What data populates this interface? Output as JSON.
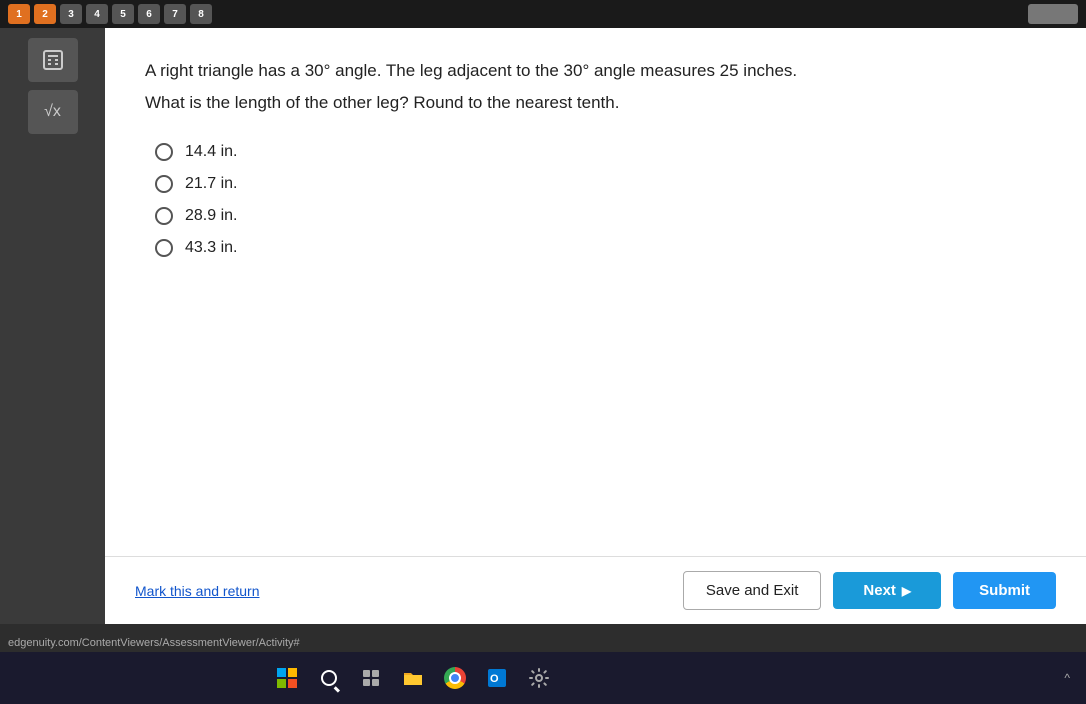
{
  "toolbar": {
    "buttons": [
      "1",
      "2",
      "3",
      "4",
      "5",
      "6",
      "7",
      "8"
    ]
  },
  "question": {
    "line1": "A right triangle has a 30° angle. The leg adjacent to the 30° angle measures 25 inches.",
    "line2": "What is the length of the other leg? Round to the nearest tenth.",
    "options": [
      {
        "id": "a",
        "label": "14.4 in."
      },
      {
        "id": "b",
        "label": "21.7 in."
      },
      {
        "id": "c",
        "label": "28.9 in."
      },
      {
        "id": "d",
        "label": "43.3 in."
      }
    ]
  },
  "footer": {
    "mark_return": "Mark this and return",
    "save_exit": "Save and Exit",
    "next": "Next",
    "submit": "Submit"
  },
  "taskbar": {
    "url": "edgenuity.com/ContentViewers/AssessmentViewer/Activity#"
  }
}
